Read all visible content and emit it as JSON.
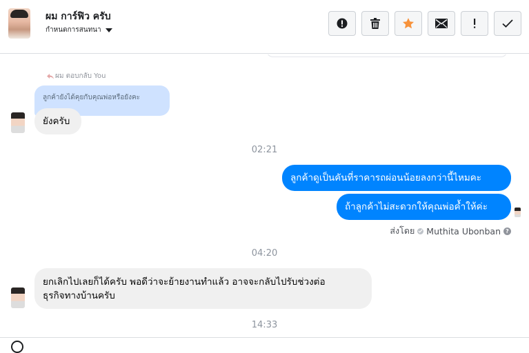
{
  "header": {
    "name": "ผม การ์ฟิว ครับ",
    "assign_label": "กำหนดการสนทนา"
  },
  "toolbar": {
    "icons": [
      "alert-circle-icon",
      "trash-icon",
      "star-icon",
      "envelope-icon",
      "exclamation-icon",
      "checkmark-icon"
    ],
    "star_color": "#f7923b"
  },
  "messages": {
    "reply_note": "ผม ตอบกลับ You",
    "reply_quote": "ลูกค้ายังได้คุยกับคุณพ่อหรือยังคะ",
    "incoming_1": "ยังครับ",
    "time_1": "02:21",
    "outgoing_1": "ลูกค้าดูเป็นคันที่ราคารถผ่อนน้อยลงกว่านี้ไหมคะ",
    "outgoing_2": "ถ้าลูกค้าไม่สะดวกให้คุณพ่อค้ำให้ค่ะ",
    "sent_by_label": "ส่งโดย",
    "sent_by_name": "Muthita Ubonban",
    "time_2": "04:20",
    "incoming_2_line1": "ยกเลิกไปเลยก็ได้ครับ พอดีว่าจะย้ายงานทำแล้ว อาจจะกลับไปรับช่วงต่อ",
    "incoming_2_line2": "ธุรกิจทางบ้านครับ",
    "time_3": "14:33"
  },
  "colors": {
    "outgoing_bubble": "#0084ff",
    "incoming_bubble": "#f0f0f0",
    "reply_quote_bg": "#cfe2ff"
  }
}
